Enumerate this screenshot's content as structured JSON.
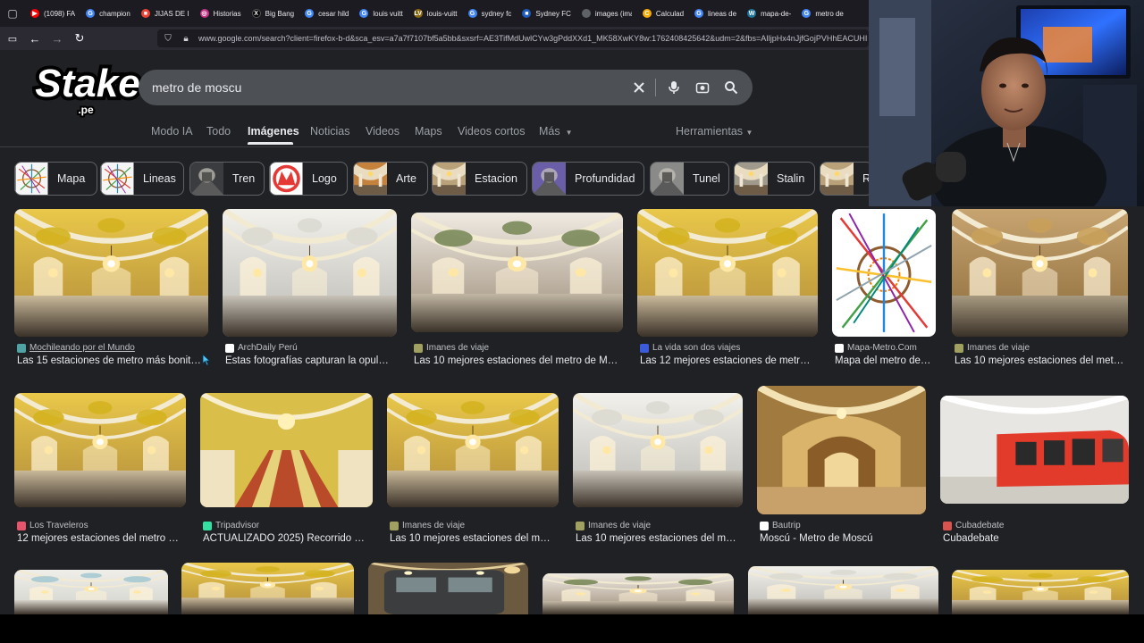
{
  "browser": {
    "tabs": [
      {
        "label": "(1098) FA",
        "color": "#ff0000",
        "glyph": "▶"
      },
      {
        "label": "champion",
        "color": "#4285f4",
        "glyph": "G"
      },
      {
        "label": "JIJAS DE I",
        "color": "#ea4335",
        "glyph": "■"
      },
      {
        "label": "Historias",
        "color": "#c13584",
        "glyph": "◎"
      },
      {
        "label": "Big Bang",
        "color": "#000000",
        "glyph": "X"
      },
      {
        "label": "cesar hild",
        "color": "#4285f4",
        "glyph": "G"
      },
      {
        "label": "louis vuitt",
        "color": "#4285f4",
        "glyph": "G"
      },
      {
        "label": "louis-vuitt",
        "color": "#8b6914",
        "glyph": "LV"
      },
      {
        "label": "sydney fc",
        "color": "#4285f4",
        "glyph": "G"
      },
      {
        "label": "Sydney FC",
        "color": "#1e5bbd",
        "glyph": "■"
      },
      {
        "label": "images (imag",
        "color": "#5f6368",
        "glyph": " "
      },
      {
        "label": "Calculad",
        "color": "#f9ab00",
        "glyph": "C"
      },
      {
        "label": "lineas de",
        "color": "#4285f4",
        "glyph": "G"
      },
      {
        "label": "mapa-de-",
        "color": "#21759b",
        "glyph": "W"
      },
      {
        "label": "metro de",
        "color": "#4285f4",
        "glyph": "G"
      }
    ],
    "url": "www.google.com/search?client=firefox-b-d&sca_esv=a7a7f7107bf5a5bb&sxsrf=AE3TifMdUwlCYw3gPddXXd1_MK58XwKY8w:1762408425642&udm=2&fbs=AIljpHx4nJjfGojPVHhEACUHI"
  },
  "logo": {
    "text": "Stake",
    "suffix": ".pe"
  },
  "search": {
    "query": "metro de moscu"
  },
  "google_tabs": [
    {
      "label": "Modo IA",
      "active": false
    },
    {
      "label": "Todo",
      "active": false
    },
    {
      "label": "Imágenes",
      "active": true
    },
    {
      "label": "Noticias",
      "active": false
    },
    {
      "label": "Videos",
      "active": false
    },
    {
      "label": "Maps",
      "active": false
    },
    {
      "label": "Videos cortos",
      "active": false
    },
    {
      "label": "Más",
      "active": false
    }
  ],
  "tools_label": "Herramientas",
  "chips": [
    {
      "label": "Mapa",
      "thumb": "map"
    },
    {
      "label": "Lineas",
      "thumb": "map"
    },
    {
      "label": "Tren",
      "thumb": "train"
    },
    {
      "label": "Logo",
      "thumb": "logo"
    },
    {
      "label": "Arte",
      "thumb": "art"
    },
    {
      "label": "Estacion",
      "thumb": "station"
    },
    {
      "label": "Profundidad",
      "thumb": "depth"
    },
    {
      "label": "Tunel",
      "thumb": "tunnel"
    },
    {
      "label": "Stalin",
      "thumb": "stalin"
    },
    {
      "label": "R",
      "thumb": "station"
    }
  ],
  "results": [
    {
      "source": "Mochileando por el Mundo",
      "title": "Las 15 estaciones de metro más bonit…",
      "style": "yellow",
      "underline": true,
      "fav": "#4fa3a5"
    },
    {
      "source": "ArchDaily Perú",
      "title": "Estas fotografías capturan la opul…",
      "style": "white",
      "fav": "#ffffff"
    },
    {
      "source": "Imanes de viaje",
      "title": "Las 10 mejores estaciones del metro de M…",
      "style": "mosaic",
      "fav": "#a0a060"
    },
    {
      "source": "La vida son dos viajes",
      "title": "Las 12 mejores estaciones de metr…",
      "style": "yellow",
      "fav": "#3b5bdb"
    },
    {
      "source": "Mapa-Metro.Com",
      "title": "Mapa del metro de…",
      "style": "map",
      "fav": "#ffffff"
    },
    {
      "source": "Imanes de viaje",
      "title": "Las 10 mejores estaciones del met…",
      "style": "gold",
      "fav": "#a0a060"
    },
    {
      "source": "Los Traveleros",
      "title": "12 mejores estaciones del metro …",
      "style": "yellow",
      "fav": "#e8546b"
    },
    {
      "source": "Tripadvisor",
      "title": "ACTUALIZADO 2025) Recorrido …",
      "style": "escalator",
      "fav": "#34e0a1"
    },
    {
      "source": "Imanes de viaje",
      "title": "Las 10 mejores estaciones del m…",
      "style": "yellow",
      "fav": "#a0a060"
    },
    {
      "source": "Imanes de viaje",
      "title": "Las 10 mejores estaciones del m…",
      "style": "white",
      "fav": "#a0a060"
    },
    {
      "source": "Bautrip",
      "title": "Moscú - Metro de Moscú",
      "style": "goldhall",
      "fav": "#ffffff"
    },
    {
      "source": "Cubadebate",
      "title": "Cubadebate",
      "style": "redtrain",
      "fav": "#d9534f"
    },
    {
      "style": "pastel"
    },
    {
      "style": "yellow"
    },
    {
      "style": "train"
    },
    {
      "style": "mosaic2"
    },
    {
      "style": "white"
    },
    {
      "style": "yellow"
    }
  ],
  "colors": {
    "page_bg": "#202124",
    "search_bg": "#4d5156",
    "logo_red": "#e01b1b"
  }
}
